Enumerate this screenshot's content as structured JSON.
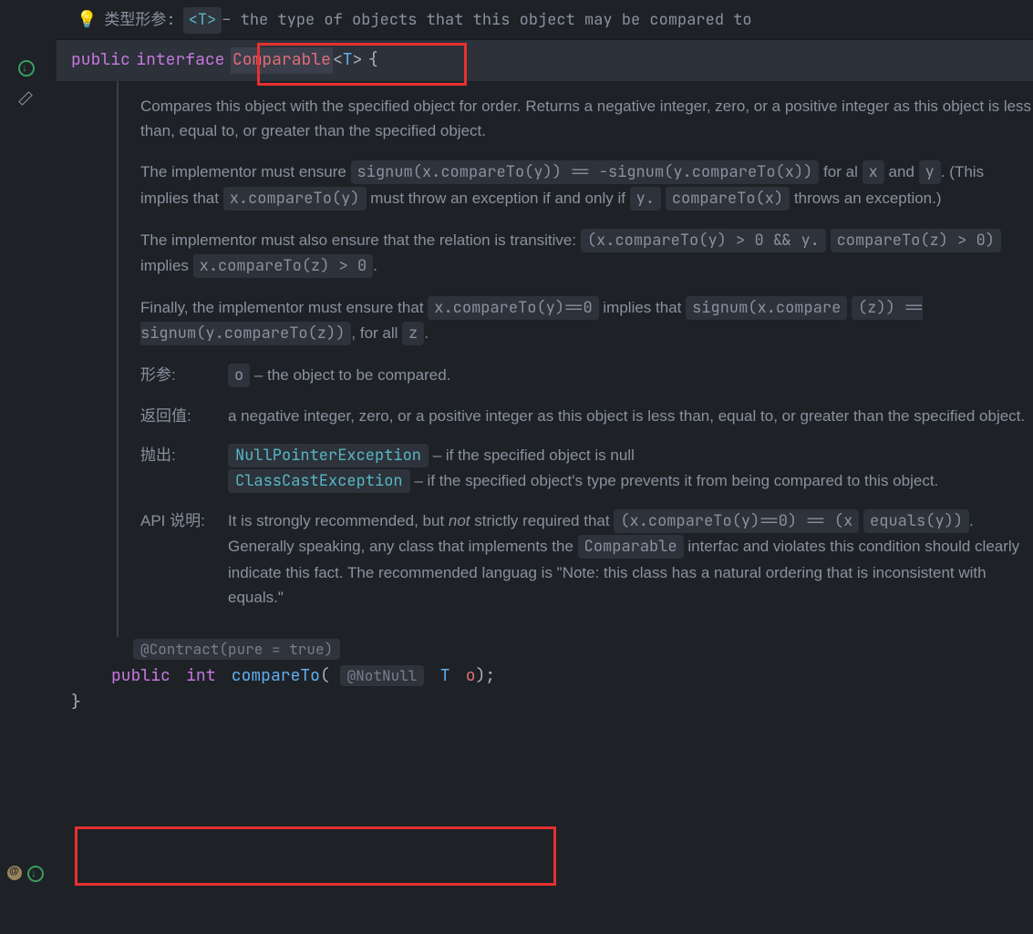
{
  "topDoc": {
    "typeParamLabel": "类型形参:",
    "typeParam": "<T>",
    "typeParamDesc": " – the type of objects that this object may be compared to"
  },
  "decl": {
    "kw1": "public",
    "kw2": "interface",
    "name": "Comparable",
    "lt": "<",
    "tparam": "T",
    "gt": ">",
    "brace": "{"
  },
  "javadoc": {
    "p1": "Compares this object with the specified object for order. Returns a negative integer, zero, or a positive integer as this object is less than, equal to, or greater than the specified object.",
    "p2a": "The implementor must ensure ",
    "p2code": "signum(x.compareTo(y)) == -signum(y.compareTo(x))",
    "p2b": " for al",
    "p2x": "x",
    "p2and": " and ",
    "p2y": "y",
    "p2c": ". (This implies that ",
    "p2code2": "x.compareTo(y)",
    "p2d": " must throw an exception if and only if ",
    "p2code3a": "y.",
    "p2code3b": "compareTo(x)",
    "p2e": " throws an exception.)",
    "p3a": "The implementor must also ensure that the relation is transitive: ",
    "p3code1a": "(x.compareTo(y) > 0 && y.",
    "p3code1b": "compareTo(z) > 0)",
    "p3b": " implies ",
    "p3code2": "x.compareTo(z) > 0",
    "p3c": ".",
    "p4a": "Finally, the implementor must ensure that ",
    "p4code1": "x.compareTo(y)==0",
    "p4b": " implies that ",
    "p4code2a": "signum(x.compare",
    "p4code2b": "(z)) == signum(y.compareTo(z))",
    "p4c": ", for all ",
    "p4z": "z",
    "p4d": ".",
    "paramLabel": "形参:",
    "paramName": "o",
    "paramDesc": " – the object to be compared.",
    "returnLabel": "返回值:",
    "returnDesc": "a negative integer, zero, or a positive integer as this object is less than, equal to, or greater than the specified object.",
    "throwsLabel": "抛出:",
    "throws1": "NullPointerException",
    "throws1Desc": " – if the specified object is null",
    "throws2": "ClassCastException",
    "throws2Desc": " – if the specified object's type prevents it from being compared to this object.",
    "apiLabel": "API 说明:",
    "api1": "It is strongly recommended, but ",
    "apiNot": "not",
    "api2": " strictly required that ",
    "apiCode1": "(x.compareTo(y)==0) == (x",
    "apiCode2": "equals(y))",
    "api3": ". Generally speaking, any class that implements the ",
    "apiCode3": "Comparable",
    "api4": " interfac and violates this condition should clearly indicate this fact. The recommended languag is \"Note: this class has a natural ordering that is inconsistent with equals.\""
  },
  "method": {
    "contract": "@Contract(pure = true)",
    "kw1": "public",
    "kw2": "int",
    "name": "compareTo",
    "lp": "(",
    "notnull": "@NotNull",
    "ptype": "T",
    "pname": "o",
    "rp": ");"
  },
  "brace": "}"
}
